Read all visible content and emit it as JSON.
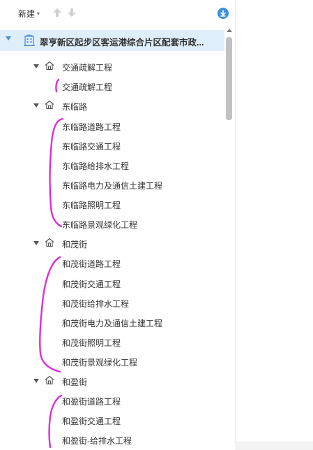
{
  "toolbar": {
    "new_label": "新建",
    "new_caret": "▾",
    "up_icon": "arrow-up-icon",
    "down_icon": "arrow-down-icon",
    "download_icon": "download-circle-icon",
    "accent_color": "#3b8fe0"
  },
  "tree": {
    "root": {
      "label": "翠亨新区起步区客运港综合片区配套市政...",
      "icon": "building-icon",
      "expanded": true
    },
    "groups": [
      {
        "label": "交通疏解工程",
        "icon": "home-icon",
        "expanded": true,
        "items": [
          "交通疏解工程"
        ]
      },
      {
        "label": "东临路",
        "icon": "home-icon",
        "expanded": true,
        "items": [
          "东临路道路工程",
          "东临路交通工程",
          "东临路给排水工程",
          "东临路电力及通信土建工程",
          "东临路照明工程",
          "东临路景观绿化工程"
        ]
      },
      {
        "label": "和茂街",
        "icon": "home-icon",
        "expanded": true,
        "items": [
          "和茂街道路工程",
          "和茂街交通工程",
          "和茂街给排水工程",
          "和茂街电力及通信土建工程",
          "和茂街照明工程",
          "和茂街景观绿化工程"
        ]
      },
      {
        "label": "和盈街",
        "icon": "home-icon",
        "expanded": true,
        "items": [
          "和盈街道路工程",
          "和盈街交通工程",
          "和盈街-给排水工程"
        ]
      }
    ]
  },
  "colors": {
    "selected_row_bg": "#dfeefb",
    "annotation_stroke": "#e02be0",
    "text": "#333333"
  }
}
